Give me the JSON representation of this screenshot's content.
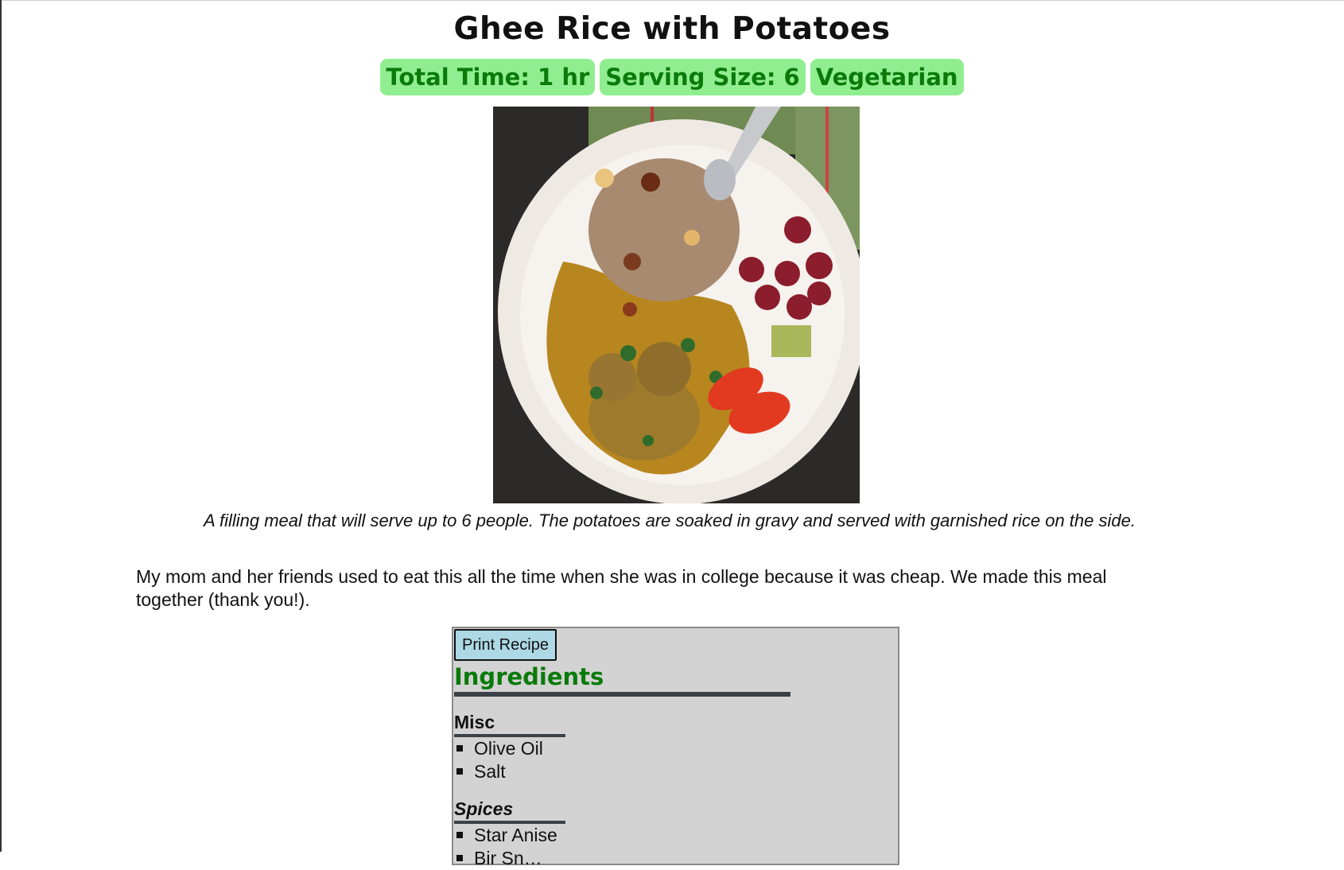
{
  "recipe": {
    "title": "Ghee Rice with Potatoes",
    "badges": [
      "Total Time: 1 hr",
      "Serving Size: 6",
      "Vegetarian"
    ],
    "caption": "A filling meal that will serve up to 6 people. The potatoes are soaked in gravy and served with garnished rice on the side.",
    "story": "My mom and her friends used to eat this all the time when she was in college because it was cheap. We made this meal together (thank you!)."
  },
  "card": {
    "print_label": "Print Recipe",
    "ingredients_title": "Ingredients",
    "groups": [
      {
        "name": "Misc",
        "items": [
          "Olive Oil",
          "Salt"
        ]
      },
      {
        "name": "Spices",
        "items": [
          "Star Anise",
          "Bir Sn…"
        ]
      }
    ]
  },
  "colors": {
    "badge_bg": "#90ee90",
    "badge_text": "#0a7a0a",
    "card_bg": "#d3d3d3",
    "button_bg": "#add8e6"
  }
}
